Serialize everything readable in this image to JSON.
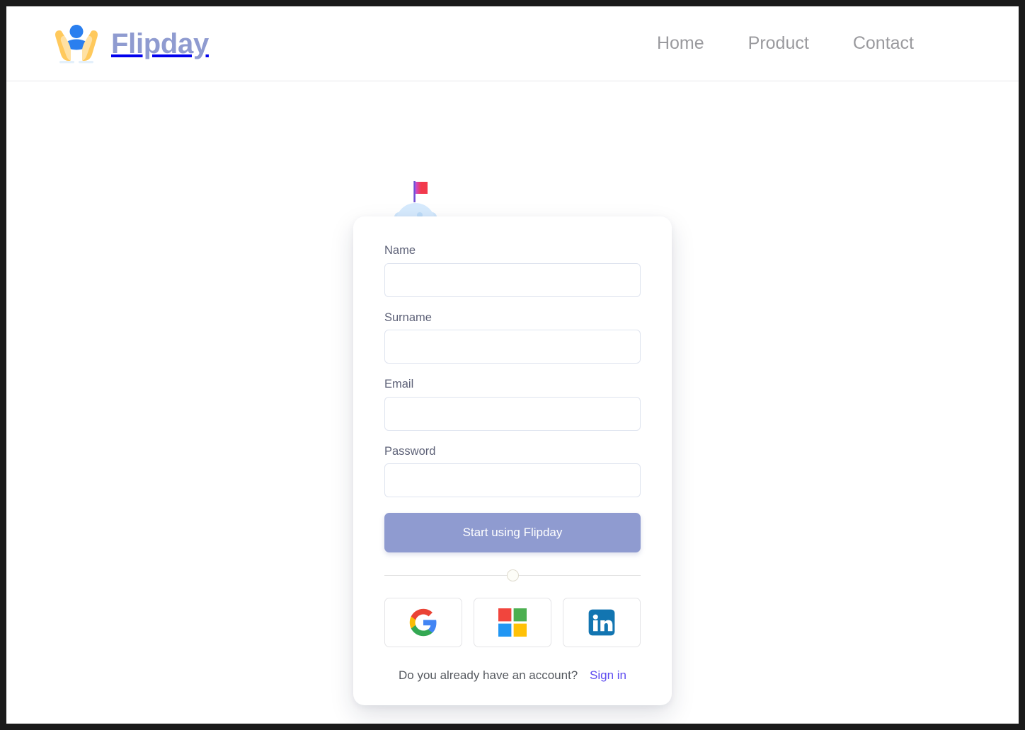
{
  "header": {
    "brand_name": "Flipday",
    "brand_icon": "hands-holding-person-icon",
    "nav": [
      {
        "label": "Home",
        "name": "nav-link-home"
      },
      {
        "label": "Product",
        "name": "nav-link-product"
      },
      {
        "label": "Contact",
        "name": "nav-link-contact"
      }
    ]
  },
  "illustration": {
    "name": "moon-with-flag-icon",
    "moon_color": "#cfe6fb",
    "flag_color": "#f2394c",
    "pole_color": "#6f4fd4"
  },
  "form": {
    "fields": [
      {
        "label": "Name",
        "value": "",
        "placeholder": "",
        "type": "text",
        "name": "name-input"
      },
      {
        "label": "Surname",
        "value": "",
        "placeholder": "",
        "type": "text",
        "name": "surname-input"
      },
      {
        "label": "Email",
        "value": "",
        "placeholder": "",
        "type": "email",
        "name": "email-input"
      },
      {
        "label": "Password",
        "value": "",
        "placeholder": "",
        "type": "password",
        "name": "password-input"
      }
    ],
    "submit_label": "Start using Flipday",
    "submit_color": "#8f9bd0"
  },
  "social": {
    "providers": [
      {
        "label": "Google",
        "icon": "google-icon",
        "name": "social-signup-google"
      },
      {
        "label": "Microsoft",
        "icon": "microsoft-icon",
        "name": "social-signup-microsoft"
      },
      {
        "label": "LinkedIn",
        "icon": "linkedin-icon",
        "name": "social-signup-linkedin"
      }
    ]
  },
  "footer": {
    "question": "Do you already have an account?",
    "signin_label": "Sign in",
    "signin_color": "#5f4df0"
  }
}
